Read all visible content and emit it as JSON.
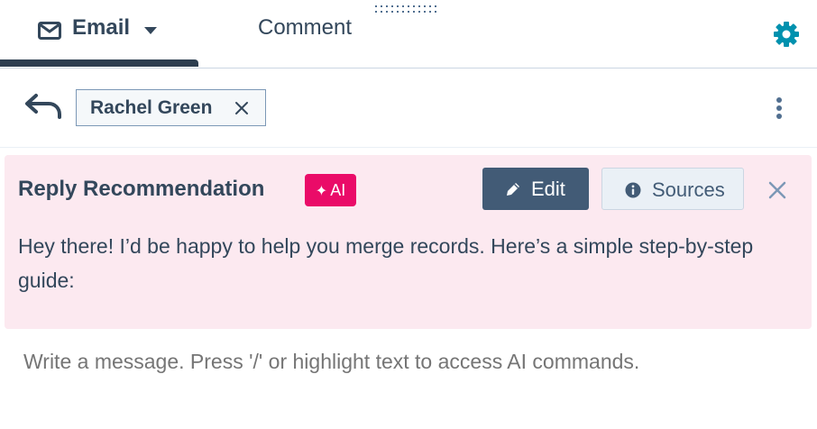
{
  "tabs": {
    "email_label": "Email",
    "comment_label": "Comment",
    "active": "Email"
  },
  "recipient": {
    "name": "Rachel Green"
  },
  "recommendation": {
    "title": "Reply Recommendation",
    "ai_badge": "AI",
    "edit_label": "Edit",
    "sources_label": "Sources",
    "body": "Hey there! I’d be happy to help you merge records. Here’s a simple step-by-step guide:"
  },
  "composer": {
    "placeholder": "Write a message. Press '/' or highlight text to access AI commands."
  },
  "icons": {
    "mail": "mail-icon",
    "caret": "chevron-down-icon",
    "gear": "gear-icon",
    "reply": "reply-icon",
    "remove": "close-icon",
    "more": "more-vertical-icon",
    "sparkle": "sparkle-icon",
    "pencil": "pencil-icon",
    "info": "info-icon"
  },
  "colors": {
    "text": "#33475b",
    "accent_teal": "#0091ae",
    "ai_pink": "#ea0b68",
    "card_bg": "#fce9f0",
    "edit_button": "#425b76"
  }
}
